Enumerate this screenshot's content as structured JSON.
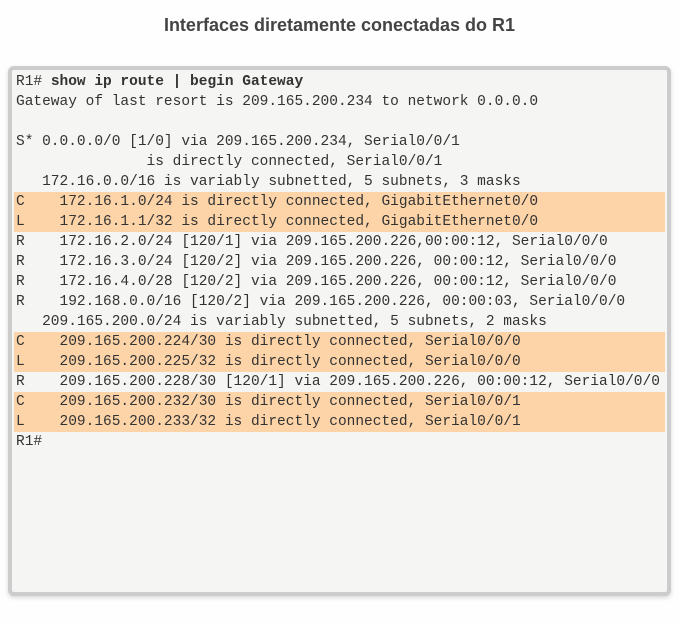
{
  "title": "Interfaces diretamente conectadas do R1",
  "prompt1": "R1# ",
  "command": "show ip route | begin Gateway",
  "lines": [
    {
      "text": "Gateway of last resort is 209.165.200.234 to network 0.0.0.0",
      "hl": false
    },
    {
      "text": "",
      "hl": false
    },
    {
      "text": "S* 0.0.0.0/0 [1/0] via 209.165.200.234, Serial0/0/1",
      "hl": false
    },
    {
      "text": "               is directly connected, Serial0/0/1",
      "hl": false
    },
    {
      "text": "   172.16.0.0/16 is variably subnetted, 5 subnets, 3 masks",
      "hl": false
    },
    {
      "text": "C    172.16.1.0/24 is directly connected, GigabitEthernet0/0",
      "hl": true
    },
    {
      "text": "L    172.16.1.1/32 is directly connected, GigabitEthernet0/0",
      "hl": true
    },
    {
      "text": "R    172.16.2.0/24 [120/1] via 209.165.200.226,00:00:12, Serial0/0/0",
      "hl": false
    },
    {
      "text": "R    172.16.3.0/24 [120/2] via 209.165.200.226, 00:00:12, Serial0/0/0",
      "hl": false
    },
    {
      "text": "R    172.16.4.0/28 [120/2] via 209.165.200.226, 00:00:12, Serial0/0/0",
      "hl": false
    },
    {
      "text": "R    192.168.0.0/16 [120/2] via 209.165.200.226, 00:00:03, Serial0/0/0",
      "hl": false
    },
    {
      "text": "   209.165.200.0/24 is variably subnetted, 5 subnets, 2 masks",
      "hl": false
    },
    {
      "text": "C    209.165.200.224/30 is directly connected, Serial0/0/0",
      "hl": true
    },
    {
      "text": "L    209.165.200.225/32 is directly connected, Serial0/0/0",
      "hl": true
    },
    {
      "text": "R    209.165.200.228/30 [120/1] via 209.165.200.226, 00:00:12, Serial0/0/0",
      "hl": false
    },
    {
      "text": "C    209.165.200.232/30 is directly connected, Serial0/0/1",
      "hl": true
    },
    {
      "text": "L    209.165.200.233/32 is directly connected, Serial0/0/1",
      "hl": true
    }
  ],
  "prompt2": "R1#"
}
